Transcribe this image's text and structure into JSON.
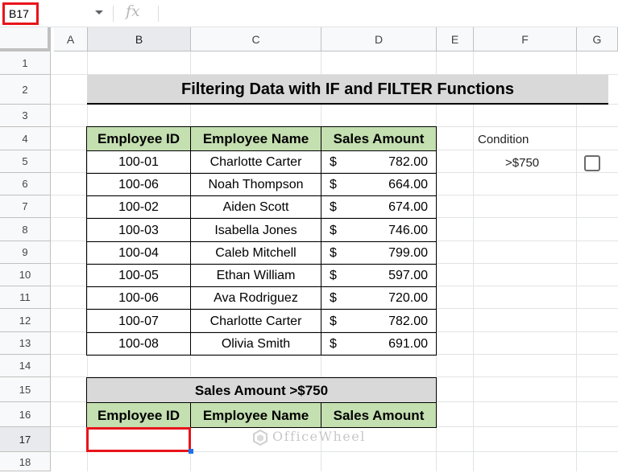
{
  "formula_bar": {
    "cell_ref": "B17",
    "fx": "fx",
    "formula": ""
  },
  "columns": [
    "A",
    "B",
    "C",
    "D",
    "E",
    "F",
    "G"
  ],
  "rows": [
    "1",
    "2",
    "3",
    "4",
    "5",
    "6",
    "7",
    "8",
    "9",
    "10",
    "11",
    "12",
    "13",
    "14",
    "15",
    "16",
    "17",
    "18"
  ],
  "title": "Filtering Data with IF and FILTER Functions",
  "table": {
    "headers": [
      "Employee ID",
      "Employee Name",
      "Sales Amount"
    ],
    "rows": [
      {
        "id": "100-01",
        "name": "Charlotte Carter",
        "cur": "$",
        "amount": "782.00"
      },
      {
        "id": "100-06",
        "name": "Noah Thompson",
        "cur": "$",
        "amount": "664.00"
      },
      {
        "id": "100-02",
        "name": "Aiden Scott",
        "cur": "$",
        "amount": "674.00"
      },
      {
        "id": "100-03",
        "name": "Isabella Jones",
        "cur": "$",
        "amount": "746.00"
      },
      {
        "id": "100-04",
        "name": "Caleb Mitchell",
        "cur": "$",
        "amount": "799.00"
      },
      {
        "id": "100-05",
        "name": "Ethan William",
        "cur": "$",
        "amount": "597.00"
      },
      {
        "id": "100-06",
        "name": "Ava Rodriguez",
        "cur": "$",
        "amount": "720.00"
      },
      {
        "id": "100-07",
        "name": "Charlotte Carter",
        "cur": "$",
        "amount": "782.00"
      },
      {
        "id": "100-08",
        "name": "Olivia Smith",
        "cur": "$",
        "amount": "691.00"
      }
    ]
  },
  "condition": {
    "label": "Condition",
    "value": ">$750",
    "checked": false
  },
  "result_table": {
    "title": "Sales Amount >$750",
    "headers": [
      "Employee ID",
      "Employee Name",
      "Sales Amount"
    ]
  },
  "watermark": "OfficeWheel"
}
